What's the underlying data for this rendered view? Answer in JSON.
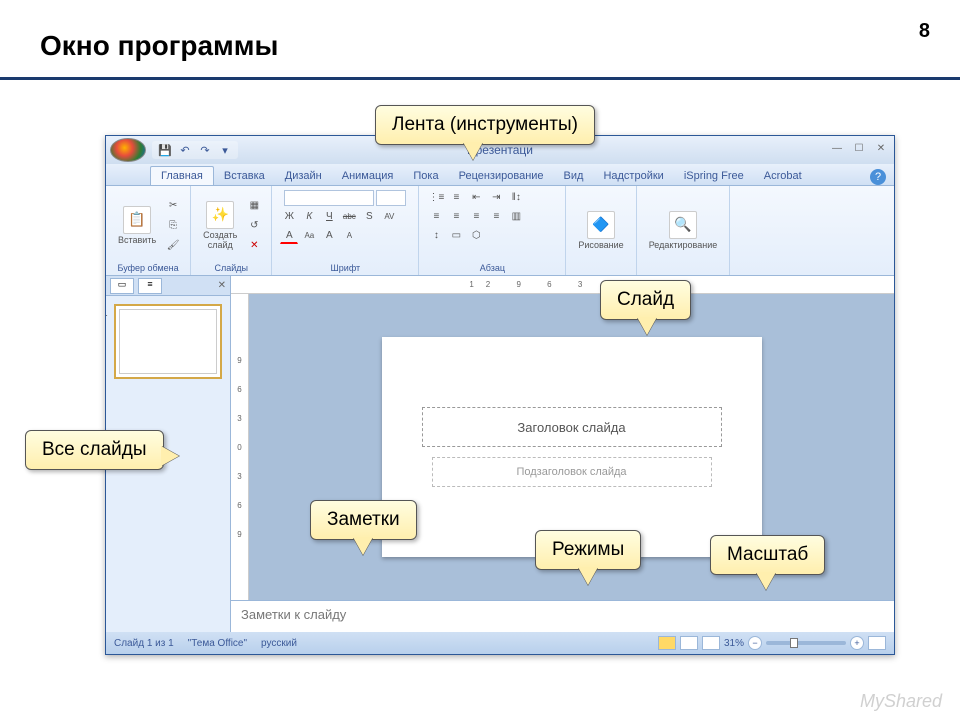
{
  "page": {
    "title": "Окно программы",
    "number": "8"
  },
  "callouts": {
    "ribbon": "Лента (инструменты)",
    "slide": "Слайд",
    "all_slides": "Все слайды",
    "notes": "Заметки",
    "modes": "Режимы",
    "zoom": "Масштаб"
  },
  "app": {
    "title": "Презентаци",
    "tabs": [
      "Главная",
      "Вставка",
      "Дизайн",
      "Анимация",
      "Пока",
      "Рецензирование",
      "Вид",
      "Надстройки",
      "iSpring Free",
      "Acrobat"
    ],
    "ribbon_groups": {
      "clipboard": {
        "label": "Буфер обмена",
        "paste": "Вставить"
      },
      "slides": {
        "label": "Слайды",
        "new_slide": "Создать\nслайд"
      },
      "font": {
        "label": "Шрифт",
        "buttons": [
          "Ж",
          "К",
          "Ч",
          "abc",
          "S",
          "AV"
        ],
        "buttons2": [
          "A",
          "Aa",
          "A",
          "A"
        ]
      },
      "paragraph": {
        "label": "Абзац"
      },
      "drawing": {
        "label": "Рисование"
      },
      "editing": {
        "label": "Редактирование"
      }
    },
    "ruler_h": "12   9   6   3   0   3",
    "ruler_v": [
      "9",
      "6",
      "3",
      "0",
      "3",
      "6",
      "9"
    ],
    "slide_title_ph": "Заголовок слайда",
    "slide_sub_ph": "Подзаголовок слайда",
    "notes_placeholder": "Заметки к слайду",
    "status": {
      "slide": "Слайд 1 из 1",
      "theme": "\"Тема Office\"",
      "lang": "русский",
      "zoom": "31%"
    }
  },
  "watermark": "MyShared"
}
